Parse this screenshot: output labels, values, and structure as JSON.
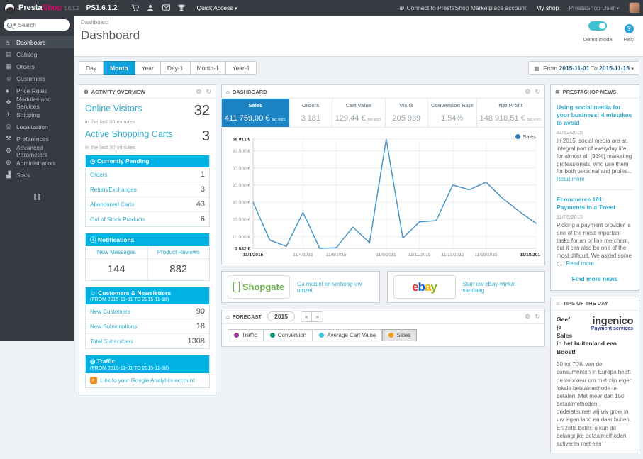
{
  "icons": {
    "caret_down": "▾",
    "calendar": "▦",
    "gear": "⚙",
    "refresh": "↻",
    "marketplace": "⊕",
    "activity": "⊚",
    "clock": "◷",
    "info": "ⓘ",
    "person": "☺",
    "globe": "◎",
    "ga": "▸",
    "cart_panel": "⌂",
    "news": "≋",
    "bulb": "☼",
    "prev": "«",
    "next": "»",
    "help": "?"
  },
  "topbar": {
    "brand_presta": "Presta",
    "brand_shop": "Shop",
    "version": "1.6.1.2",
    "shop_name": "PS1.6.1.2",
    "quick_access": "Quick Access",
    "marketplace_link": "Connect to PrestaShop Marketplace account",
    "my_shop": "My shop",
    "user": "PrestaShop User"
  },
  "sidebar": {
    "search_placeholder": "Search",
    "items": [
      {
        "label": "Dashboard",
        "glyph": "⌂",
        "active": true
      },
      {
        "label": "Catalog",
        "glyph": "▤"
      },
      {
        "label": "Orders",
        "glyph": "▦"
      },
      {
        "label": "Customers",
        "glyph": "☺"
      },
      {
        "label": "Price Rules",
        "glyph": "♦"
      },
      {
        "label": "Modules and Services",
        "glyph": "❖"
      },
      {
        "label": "Shipping",
        "glyph": "✈"
      },
      {
        "label": "Localization",
        "glyph": "◎"
      },
      {
        "label": "Preferences",
        "glyph": "⚒"
      },
      {
        "label": "Advanced Parameters",
        "glyph": "⚙"
      },
      {
        "label": "Administration",
        "glyph": "⊛"
      },
      {
        "label": "Stats",
        "glyph": "▟"
      }
    ]
  },
  "header": {
    "breadcrumb": "Dashboard",
    "title": "Dashboard",
    "demo_mode_label": "Demo mode",
    "demo_mode_on": true,
    "help_label": "Help"
  },
  "toolbar": {
    "ranges": [
      {
        "label": "Day"
      },
      {
        "label": "Month",
        "active": true
      },
      {
        "label": "Year"
      },
      {
        "label": "Day-1"
      },
      {
        "label": "Month-1"
      },
      {
        "label": "Year-1"
      }
    ],
    "from_label": "From",
    "from_date": "2015-11-01",
    "to_label": "To",
    "to_date": "2015-11-18"
  },
  "activity": {
    "title": "ACTIVITY OVERVIEW",
    "online_visitors": {
      "label": "Online Visitors",
      "sub": "in the last 30 minutes",
      "value": "32"
    },
    "active_carts": {
      "label": "Active Shopping Carts",
      "sub": "in the last 30 minutes",
      "value": "3"
    },
    "pending": {
      "title": "Currently Pending",
      "rows": [
        {
          "label": "Orders",
          "value": "1"
        },
        {
          "label": "Return/Exchanges",
          "value": "3"
        },
        {
          "label": "Abandoned Carts",
          "value": "43"
        },
        {
          "label": "Out of Stock Products",
          "value": "6"
        }
      ]
    },
    "notifications": {
      "title": "Notifications",
      "cols": [
        {
          "label": "New Messages",
          "value": "144"
        },
        {
          "label": "Product Reviews",
          "value": "882"
        }
      ]
    },
    "customers": {
      "title": "Customers & Newsletters",
      "subtitle": "(FROM 2015-11-01 TO 2015-11-18)",
      "rows": [
        {
          "label": "New Customers",
          "value": "90"
        },
        {
          "label": "New Subscriptions",
          "value": "18"
        },
        {
          "label": "Total Subscribers",
          "value": "1308"
        }
      ]
    },
    "traffic": {
      "title": "Traffic",
      "subtitle": "(FROM 2015-11-01 TO 2015-11-18)",
      "link": "Link to your Google Analytics account"
    }
  },
  "dashboard_panel": {
    "title": "DASHBOARD",
    "kpis": [
      {
        "label": "Sales",
        "value": "411 759,00 €",
        "suffix": "tax excl.",
        "active": true
      },
      {
        "label": "Orders",
        "value": "3 181",
        "suffix": ""
      },
      {
        "label": "Cart Value",
        "value": "129,44 €",
        "suffix": "tax excl."
      },
      {
        "label": "Visits",
        "value": "205 939",
        "suffix": ""
      },
      {
        "label": "Conversion Rate",
        "value": "1.54%",
        "suffix": ""
      },
      {
        "label": "Net Profit",
        "value": "148 918,51 €",
        "suffix": "tax excl."
      }
    ],
    "legend": "Sales"
  },
  "chart_data": {
    "type": "line",
    "title": "Sales",
    "x": [
      "11/1/2015",
      "11/2/2015",
      "11/3/2015",
      "11/4/2015",
      "11/5/2015",
      "11/6/2015",
      "11/7/2015",
      "11/8/2015",
      "11/9/2015",
      "11/10/2015",
      "11/11/2015",
      "11/12/2015",
      "11/13/2015",
      "11/14/2015",
      "11/15/2015",
      "11/16/2015",
      "11/17/2015",
      "11/18/2015"
    ],
    "series": [
      {
        "name": "Sales",
        "color": "#4a96c8",
        "values": [
          30000,
          7900,
          4200,
          24100,
          3082,
          3400,
          15500,
          6300,
          66912,
          9100,
          18500,
          19200,
          40000,
          37300,
          41700,
          32200,
          24600,
          17700
        ]
      }
    ],
    "ylim": [
      3082,
      66912
    ],
    "grid": true,
    "legend_position": "top-right",
    "y_ticks": [
      {
        "label": "66 912 €",
        "value": 66912,
        "bold": true
      },
      {
        "label": "60 000 €",
        "value": 60000
      },
      {
        "label": "50 000 €",
        "value": 50000
      },
      {
        "label": "40 000 €",
        "value": 40000
      },
      {
        "label": "30 000 €",
        "value": 30000
      },
      {
        "label": "20 000 €",
        "value": 20000
      },
      {
        "label": "10 000 €",
        "value": 10000
      },
      {
        "label": "3 082 €",
        "value": 3082,
        "bold": true
      }
    ],
    "x_ticks": [
      {
        "label": "11/1/2015",
        "index": 0,
        "bold": true
      },
      {
        "label": "11/4/2015",
        "index": 3
      },
      {
        "label": "11/6/2015",
        "index": 5
      },
      {
        "label": "11/9/2015",
        "index": 8
      },
      {
        "label": "11/11/2015",
        "index": 10
      },
      {
        "label": "11/13/2015",
        "index": 12
      },
      {
        "label": "11/15/2015",
        "index": 14
      },
      {
        "label": "11/18/201",
        "index": 17,
        "bold": true
      }
    ]
  },
  "modules": {
    "shopgate": {
      "name": "Shopgate",
      "link": "Ga mobiel en verhoog uw omzet"
    },
    "ebay": {
      "e": "e",
      "b": "b",
      "a": "a",
      "y": "y",
      "link": "Start uw eBay-winkel vandaag"
    }
  },
  "forecast": {
    "title": "FORECAST",
    "year": "2015",
    "metrics": [
      {
        "label": "Traffic",
        "color": "#9b3d98"
      },
      {
        "label": "Conversion",
        "color": "#0e9280"
      },
      {
        "label": "Average Cart Value",
        "color": "#3ec4e0"
      },
      {
        "label": "Sales",
        "color": "#f39b1f",
        "selected": true
      }
    ]
  },
  "news": {
    "title": "PRESTASHOP NEWS",
    "items": [
      {
        "title": "Using social media for your business: 4 mistakes to avoid",
        "date": "11/12/2015",
        "text": "In 2015, social media are an integral part of everyday life for almost all (96%) marketing professionals, who use them for both personal and profes...",
        "read_more": "Read more"
      },
      {
        "title": "Ecommerce 101: Payments in a Tweet",
        "date": "11/05/2015",
        "text": "Picking a payment provider is one of the most important tasks for an online merchant, but it can also be one of the most difficult. We asked some o...",
        "read_more": "Read more"
      }
    ],
    "find_more": "Find more news"
  },
  "tips": {
    "title": "TIPS OF THE DAY",
    "logo_main": "ingenico",
    "logo_sub": "Payment services",
    "headline": "Geef je Sales in het buitenland een Boost!",
    "text": "30 tot 70% van de consumenten in Europa heeft de voorkeur om met zijn eigen lokale betaalmethode te betalen. Met meer dan 150 betaalmethoden, ondersteunen wij uw groei in uw eigen land en daar buiten. En zelfs beter: u kun de belangrijke betaalmethoden activeren met een"
  },
  "colors": {
    "accent_cyan": "#00b2e3",
    "kpi_active_blue": "#1d84c4",
    "link_blue": "#2eacce",
    "chart_line": "#4a96c8",
    "topbar_bg": "#363a41",
    "brand_pink": "#df0067",
    "ga_orange": "#f28b20"
  }
}
